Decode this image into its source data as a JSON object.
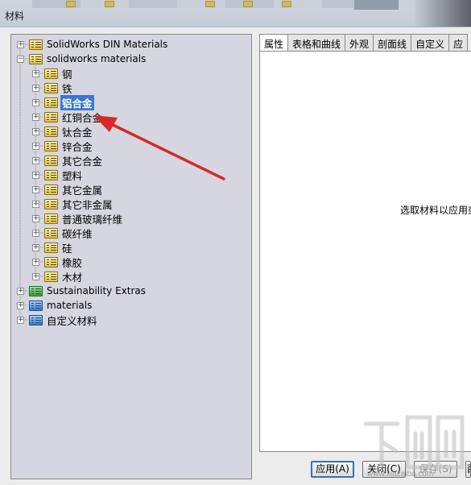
{
  "window": {
    "title": "材料"
  },
  "tree": {
    "items": [
      {
        "label": "SolidWorks DIN Materials",
        "expander": "+"
      },
      {
        "label": "solidworks materials",
        "expander": "−"
      },
      {
        "label": "钢",
        "expander": "+"
      },
      {
        "label": "铁",
        "expander": "+"
      },
      {
        "label": "铝合金",
        "expander": "+"
      },
      {
        "label": "红铜合金",
        "expander": "+"
      },
      {
        "label": "钛合金",
        "expander": "+"
      },
      {
        "label": "锌合金",
        "expander": "+"
      },
      {
        "label": "其它合金",
        "expander": "+"
      },
      {
        "label": "塑料",
        "expander": "+"
      },
      {
        "label": "其它金属",
        "expander": "+"
      },
      {
        "label": "其它非金属",
        "expander": "+"
      },
      {
        "label": "普通玻璃纤维",
        "expander": "+"
      },
      {
        "label": "碳纤维",
        "expander": "+"
      },
      {
        "label": "硅",
        "expander": "+"
      },
      {
        "label": "橡胶",
        "expander": "+"
      },
      {
        "label": "木材",
        "expander": "+"
      },
      {
        "label": "Sustainability Extras",
        "expander": "+"
      },
      {
        "label": "materials",
        "expander": "+"
      },
      {
        "label": "自定义材料",
        "expander": "+"
      }
    ]
  },
  "tabs": [
    {
      "label": "属性"
    },
    {
      "label": "表格和曲线"
    },
    {
      "label": "外观"
    },
    {
      "label": "剖面线"
    },
    {
      "label": "自定义"
    },
    {
      "label": "应"
    }
  ],
  "content": {
    "hint": "选取材料以应用或"
  },
  "buttons": {
    "apply": "应用(A)",
    "close": "关闭(C)",
    "save": "保存(S)",
    "extra": "西"
  },
  "watermark": {
    "text": "www.xiazaiba.com"
  },
  "colors": {
    "selection": "#3a78d0",
    "annotation_arrow": "#d42a2a",
    "tree_background": "#d6d6e0"
  }
}
